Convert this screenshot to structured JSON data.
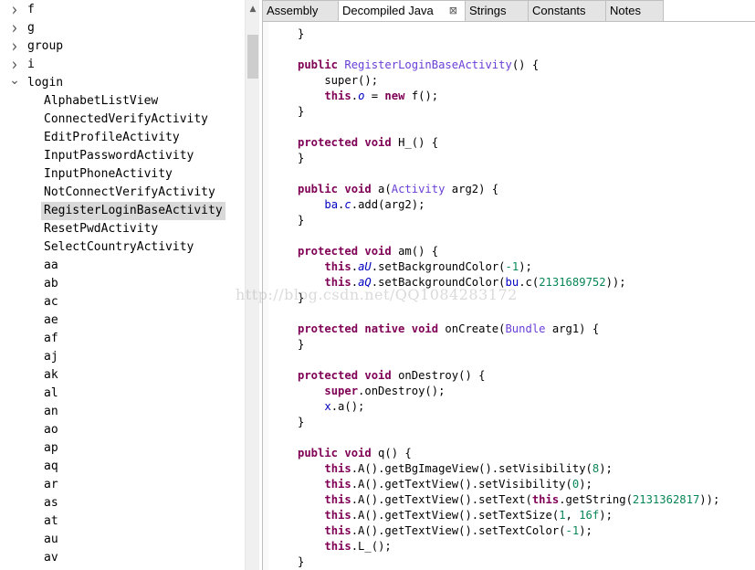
{
  "tree": {
    "top_items": [
      {
        "label": "f",
        "expanded": false
      },
      {
        "label": "g",
        "expanded": false
      },
      {
        "label": "group",
        "expanded": false
      },
      {
        "label": "i",
        "expanded": false
      },
      {
        "label": "login",
        "expanded": true
      }
    ],
    "children": [
      "AlphabetListView",
      "ConnectedVerifyActivity",
      "EditProfileActivity",
      "InputPasswordActivity",
      "InputPhoneActivity",
      "NotConnectVerifyActivity",
      "RegisterLoginBaseActivity",
      "ResetPwdActivity",
      "SelectCountryActivity",
      "aa",
      "ab",
      "ac",
      "ae",
      "af",
      "aj",
      "ak",
      "al",
      "an",
      "ao",
      "ap",
      "aq",
      "ar",
      "as",
      "at",
      "au",
      "av"
    ],
    "selected": "RegisterLoginBaseActivity"
  },
  "tabs": [
    {
      "label": "Assembly",
      "active": false
    },
    {
      "label": "Decompiled Java",
      "active": true,
      "closable": true
    },
    {
      "label": "Strings",
      "active": false
    },
    {
      "label": "Constants",
      "active": false
    },
    {
      "label": "Notes",
      "active": false
    }
  ],
  "code": [
    [
      [
        "t",
        "}"
      ]
    ],
    [],
    [
      [
        "k",
        "public"
      ],
      [
        "t",
        " "
      ],
      [
        "y",
        "RegisterLoginBaseActivity"
      ],
      [
        "t",
        "() {"
      ]
    ],
    [
      [
        "t",
        "    super();"
      ]
    ],
    [
      [
        "t",
        "    "
      ],
      [
        "k",
        "this"
      ],
      [
        "t",
        "."
      ],
      [
        "f",
        "o"
      ],
      [
        "t",
        " = "
      ],
      [
        "k",
        "new"
      ],
      [
        "t",
        " f();"
      ]
    ],
    [
      [
        "t",
        "}"
      ]
    ],
    [],
    [
      [
        "k",
        "protected void"
      ],
      [
        "t",
        " H_() {"
      ]
    ],
    [
      [
        "t",
        "}"
      ]
    ],
    [],
    [
      [
        "k",
        "public void"
      ],
      [
        "t",
        " a("
      ],
      [
        "y",
        "Activity"
      ],
      [
        "t",
        " arg2) {"
      ]
    ],
    [
      [
        "t",
        "    "
      ],
      [
        "c",
        "ba"
      ],
      [
        "t",
        "."
      ],
      [
        "f",
        "c"
      ],
      [
        "t",
        ".add(arg2);"
      ]
    ],
    [
      [
        "t",
        "}"
      ]
    ],
    [],
    [
      [
        "k",
        "protected void"
      ],
      [
        "t",
        " am() {"
      ]
    ],
    [
      [
        "t",
        "    "
      ],
      [
        "k",
        "this"
      ],
      [
        "t",
        "."
      ],
      [
        "f",
        "aU"
      ],
      [
        "t",
        ".setBackgroundColor("
      ],
      [
        "n",
        "-1"
      ],
      [
        "t",
        ");"
      ]
    ],
    [
      [
        "t",
        "    "
      ],
      [
        "k",
        "this"
      ],
      [
        "t",
        "."
      ],
      [
        "f",
        "aQ"
      ],
      [
        "t",
        ".setBackgroundColor("
      ],
      [
        "c",
        "bu"
      ],
      [
        "t",
        ".c("
      ],
      [
        "n",
        "2131689752"
      ],
      [
        "t",
        "));"
      ]
    ],
    [
      [
        "t",
        "}"
      ]
    ],
    [],
    [
      [
        "k",
        "protected native void"
      ],
      [
        "t",
        " onCreate("
      ],
      [
        "y",
        "Bundle"
      ],
      [
        "t",
        " arg1) {"
      ]
    ],
    [
      [
        "t",
        "}"
      ]
    ],
    [],
    [
      [
        "k",
        "protected void"
      ],
      [
        "t",
        " onDestroy() {"
      ]
    ],
    [
      [
        "t",
        "    "
      ],
      [
        "k",
        "super"
      ],
      [
        "t",
        ".onDestroy();"
      ]
    ],
    [
      [
        "t",
        "    "
      ],
      [
        "c",
        "x"
      ],
      [
        "t",
        ".a();"
      ]
    ],
    [
      [
        "t",
        "}"
      ]
    ],
    [],
    [
      [
        "k",
        "public void"
      ],
      [
        "t",
        " q() {"
      ]
    ],
    [
      [
        "t",
        "    "
      ],
      [
        "k",
        "this"
      ],
      [
        "t",
        ".A().getBgImageView().setVisibility("
      ],
      [
        "n",
        "8"
      ],
      [
        "t",
        ");"
      ]
    ],
    [
      [
        "t",
        "    "
      ],
      [
        "k",
        "this"
      ],
      [
        "t",
        ".A().getTextView().setVisibility("
      ],
      [
        "n",
        "0"
      ],
      [
        "t",
        ");"
      ]
    ],
    [
      [
        "t",
        "    "
      ],
      [
        "k",
        "this"
      ],
      [
        "t",
        ".A().getTextView().setText("
      ],
      [
        "k",
        "this"
      ],
      [
        "t",
        ".getString("
      ],
      [
        "n",
        "2131362817"
      ],
      [
        "t",
        "));"
      ]
    ],
    [
      [
        "t",
        "    "
      ],
      [
        "k",
        "this"
      ],
      [
        "t",
        ".A().getTextView().setTextSize("
      ],
      [
        "n",
        "1"
      ],
      [
        "t",
        ", "
      ],
      [
        "n",
        "16f"
      ],
      [
        "t",
        ");"
      ]
    ],
    [
      [
        "t",
        "    "
      ],
      [
        "k",
        "this"
      ],
      [
        "t",
        ".A().getTextView().setTextColor("
      ],
      [
        "n",
        "-1"
      ],
      [
        "t",
        ");"
      ]
    ],
    [
      [
        "t",
        "    "
      ],
      [
        "k",
        "this"
      ],
      [
        "t",
        ".L_();"
      ]
    ],
    [
      [
        "t",
        "}"
      ]
    ]
  ],
  "watermark": "http://blog.csdn.net/QQ1084283172",
  "icons": {
    "collapsed": "chevron-right-icon",
    "expanded": "chevron-down-icon",
    "close": "close-icon"
  }
}
